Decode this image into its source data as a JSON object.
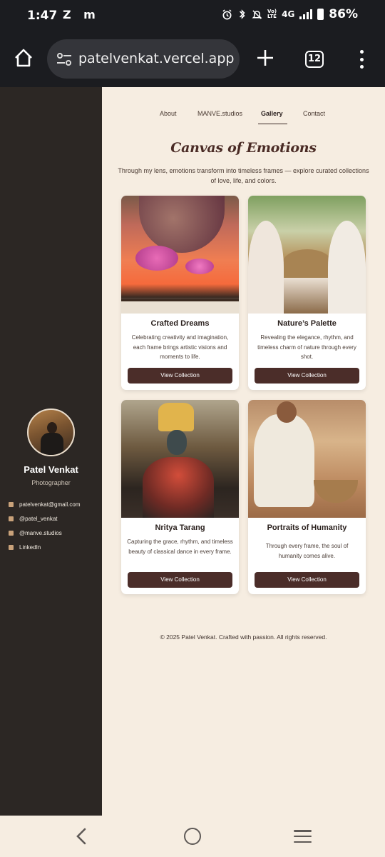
{
  "status_bar": {
    "time": "1:47",
    "notification_glyphs": "Z m",
    "network_label": "4G",
    "battery": "86%",
    "icons": [
      "alarm-icon",
      "bluetooth-icon",
      "mute-icon",
      "volte-icon",
      "signal-icon",
      "battery-icon"
    ]
  },
  "browser": {
    "url": "patelvenkat.vercel.app",
    "tab_count": "12"
  },
  "sidebar": {
    "name": "Patel Venkat",
    "role": "Photographer",
    "contacts": [
      {
        "icon": "mail-icon",
        "label": "patelvenkat@gmail.com"
      },
      {
        "icon": "instagram-icon",
        "label": "@patel_venkat"
      },
      {
        "icon": "instagram-icon",
        "label": "@manve.studios"
      },
      {
        "icon": "linkedin-icon",
        "label": "LinkedIn"
      }
    ]
  },
  "nav": {
    "items": [
      "About",
      "MANVE.studios",
      "Gallery",
      "Contact"
    ],
    "active": "Gallery"
  },
  "hero": {
    "title": "Canvas of Emotions",
    "subtitle": "Through my lens, emotions transform into timeless frames — explore curated collections of love, life, and colors."
  },
  "gallery": [
    {
      "title": "Crafted Dreams",
      "description": "Celebrating creativity and imagination, each frame brings artistic visions and moments to life.",
      "button": "View Collection"
    },
    {
      "title": "Nature’s Palette",
      "description": "Revealing the elegance, rhythm, and timeless charm of nature through every shot.",
      "button": "View Collection"
    },
    {
      "title": "Nritya Tarang",
      "description": "Capturing the grace, rhythm, and timeless beauty of classical dance in every frame.",
      "button": "View Collection"
    },
    {
      "title": "Portraits of Humanity",
      "description": "Through every frame, the soul of humanity comes alive.",
      "button": "View Collection"
    }
  ],
  "footer": "© 2025 Patel Venkat. Crafted with passion. All rights reserved.",
  "colors": {
    "accent": "#4b2d29",
    "sidebar_bg": "#2c2724",
    "page_bg": "#f6ede1",
    "browser_chrome": "#1b1c20"
  }
}
